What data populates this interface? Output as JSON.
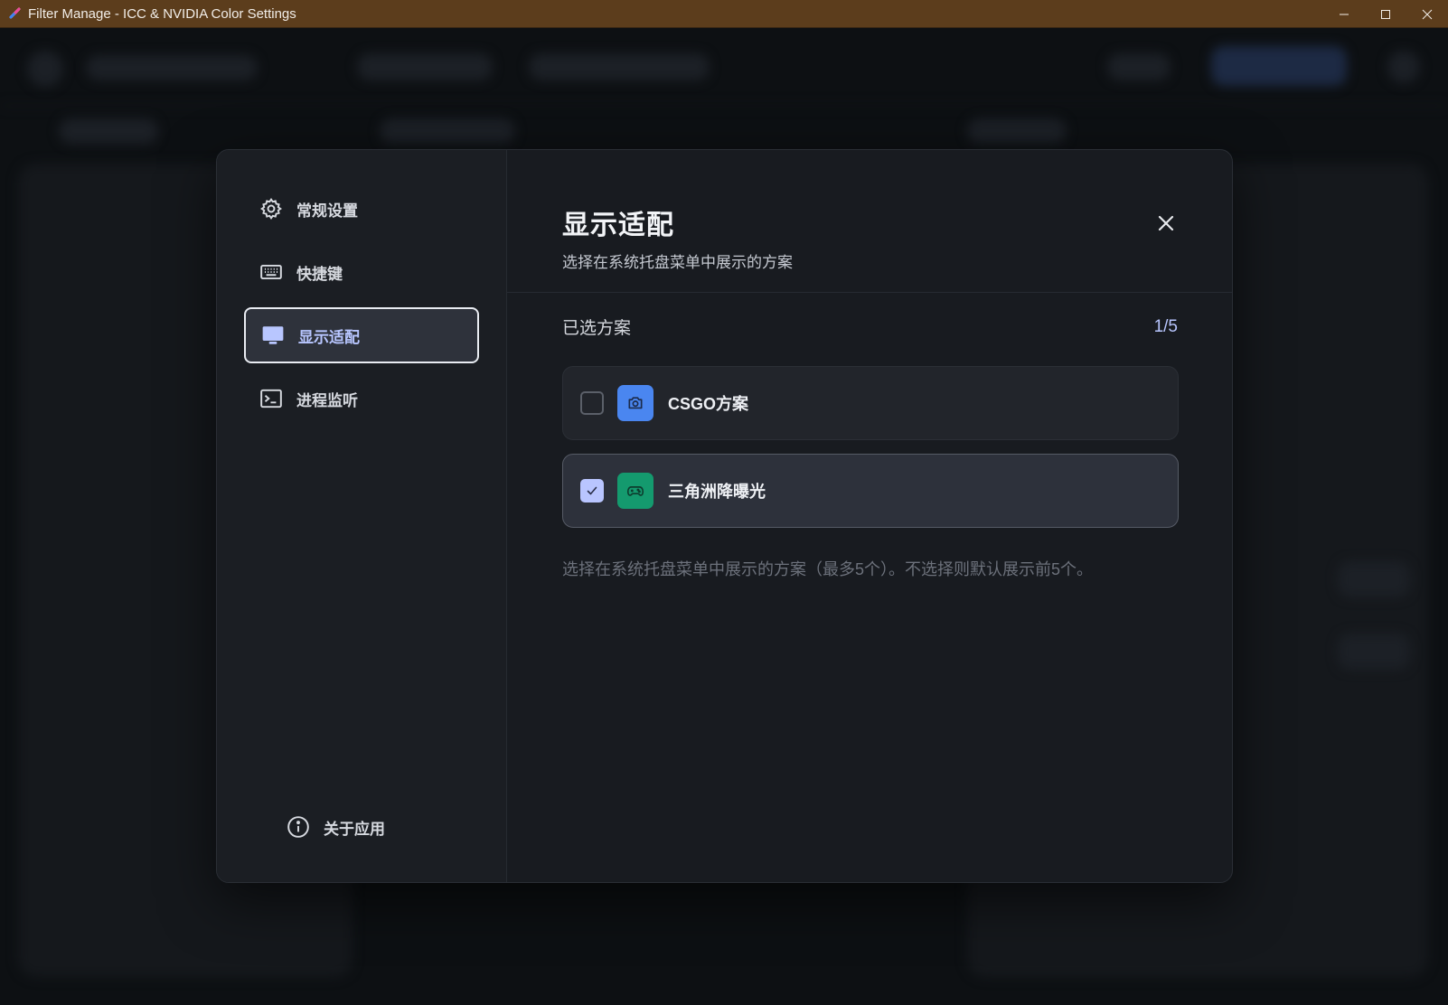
{
  "window": {
    "title": "Filter Manage - ICC & NVIDIA Color Settings",
    "minimize_glyph": "─",
    "maximize_glyph": "☐",
    "close_glyph": "✕"
  },
  "sidebar": {
    "items": [
      {
        "label": "常规设置",
        "icon": "gear-icon"
      },
      {
        "label": "快捷键",
        "icon": "keyboard-icon"
      },
      {
        "label": "显示适配",
        "icon": "monitor-icon",
        "active": true
      },
      {
        "label": "进程监听",
        "icon": "terminal-icon"
      }
    ],
    "about": {
      "label": "关于应用",
      "icon": "info-icon"
    }
  },
  "content": {
    "title": "显示适配",
    "subtitle": "选择在系统托盘菜单中展示的方案",
    "section_label": "已选方案",
    "selected_count": "1/5",
    "schemes": [
      {
        "name": "CSGO方案",
        "checked": false,
        "icon": "camera-icon",
        "icon_color": "#4a86f0"
      },
      {
        "name": "三角洲降曝光",
        "checked": true,
        "icon": "gamepad-icon",
        "icon_color": "#149a6e"
      }
    ],
    "hint": "选择在系统托盘菜单中展示的方案（最多5个）。不选择则默认展示前5个。"
  },
  "colors": {
    "titlebar": "#5c3d1c",
    "accent": "#b8c6ff",
    "modal_bg": "#181b20"
  }
}
